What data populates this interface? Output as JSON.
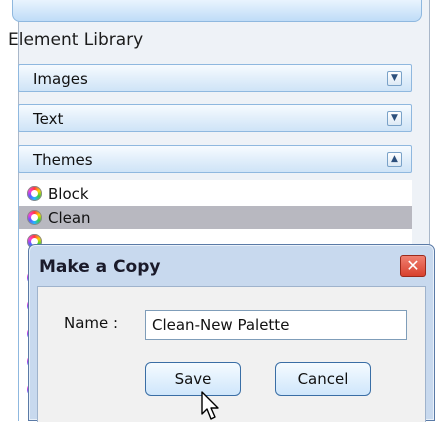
{
  "library": {
    "title": "Element Library",
    "sections": [
      {
        "label": "Images",
        "toggle": "▼",
        "expanded": false
      },
      {
        "label": "Text",
        "toggle": "▼",
        "expanded": false
      },
      {
        "label": "Themes",
        "toggle": "▲",
        "expanded": true
      }
    ],
    "themes": [
      {
        "label": "Block",
        "selected": false
      },
      {
        "label": "Clean",
        "selected": true
      }
    ]
  },
  "dialog": {
    "title": "Make a Copy",
    "close_glyph": "✕",
    "name_label": "Name :",
    "name_value": "Clean-New Palette",
    "save_label": "Save",
    "cancel_label": "Cancel"
  },
  "colors": {
    "accent": "#8fb8df",
    "selection": "#b8b8c0",
    "close_red": "#d8412e"
  },
  "icons": {
    "theme": "color-wheel-icon",
    "cursor": "mouse-pointer-icon"
  }
}
